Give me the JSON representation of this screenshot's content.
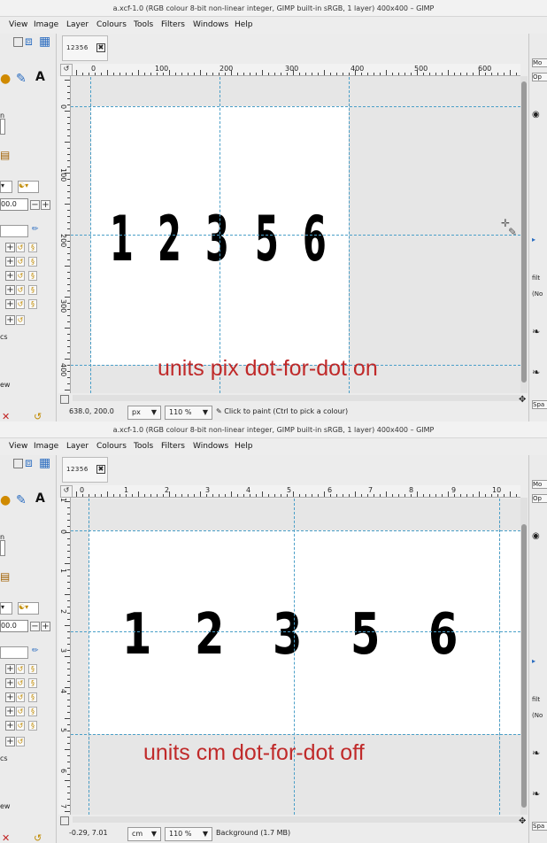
{
  "windows": [
    {
      "title": "a.xcf-1.0 (RGB colour 8-bit non-linear integer, GIMP built-in sRGB, 1 layer) 400x400 – GIMP",
      "menu": [
        "View",
        "Image",
        "Layer",
        "Colours",
        "Tools",
        "Filters",
        "Windows",
        "Help"
      ],
      "image_tab": {
        "thumb_text": "12356",
        "close_glyph": "✖"
      },
      "toolbox": {
        "size_value": "00.0",
        "labels": [
          "n",
          "cs",
          "ew"
        ]
      },
      "dock": {
        "cells": [
          "Mo",
          "Op",
          "◉",
          "▸",
          "filt",
          "(No",
          "❧",
          "❧",
          "Spa"
        ]
      },
      "ruler": {
        "h_labels": [
          "0",
          "100",
          "200",
          "300",
          "400",
          "500",
          "600"
        ],
        "v_labels": [
          "0",
          "100",
          "200",
          "300",
          "400"
        ]
      },
      "canvas_text": [
        "1",
        "2",
        "3",
        "5",
        "6"
      ],
      "annotation": "units pix     dot-for-dot on",
      "status": {
        "coords": "638.0, 200.0",
        "unit": "px",
        "zoom": "110 %",
        "message": "Click to paint (Ctrl to pick a colour)"
      }
    },
    {
      "title": "a.xcf-1.0 (RGB colour 8-bit non-linear integer, GIMP built-in sRGB, 1 layer) 400x400 – GIMP",
      "menu": [
        "View",
        "Image",
        "Layer",
        "Colours",
        "Tools",
        "Filters",
        "Windows",
        "Help"
      ],
      "image_tab": {
        "thumb_text": "12356",
        "close_glyph": "✖"
      },
      "toolbox": {
        "size_value": "00.0",
        "labels": [
          "n",
          "cs",
          "ew"
        ]
      },
      "dock": {
        "cells": [
          "Mo",
          "Op",
          "◉",
          "▸",
          "filt",
          "(No",
          "❧",
          "❧",
          "Spa"
        ]
      },
      "ruler": {
        "h_labels": [
          "0",
          "1",
          "2",
          "3",
          "4",
          "5",
          "6",
          "7",
          "8",
          "9",
          "10"
        ],
        "v_labels": [
          "1",
          "0",
          "1",
          "2",
          "3",
          "4",
          "5",
          "6",
          "7"
        ]
      },
      "canvas_text": [
        "1",
        "2",
        "3",
        "5",
        "6"
      ],
      "annotation": "units cm  dot-for-dot off",
      "status": {
        "coords": "-0.29, 7.01",
        "unit": "cm",
        "zoom": "110 %",
        "message": "Background (1.7 MB)"
      }
    }
  ]
}
